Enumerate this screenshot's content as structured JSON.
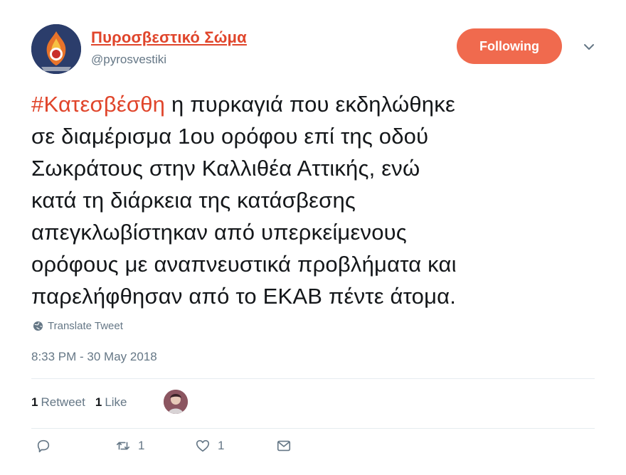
{
  "author": {
    "display_name": "Πυροσβεστικό Σώμα",
    "handle": "@pyrosvestiki"
  },
  "follow_button": {
    "label": "Following"
  },
  "tweet": {
    "hashtag": "#Κατεσβέσθη",
    "lines": [
      " η πυρκαγιά που εκδηλώθηκε",
      "σε διαμέρισμα 1ου ορόφου επί της οδού",
      "Σωκράτους στην Καλλιθέα Αττικής, ενώ",
      "κατά τη διάρκεια της κατάσβεσης",
      "απεγκλωβίστηκαν από υπερκείμενους",
      "ορόφους με αναπνευστικά προβλήματα και",
      "παρελήφθησαν από το ΕΚΑΒ πέντε άτομα."
    ]
  },
  "translate_label": "Translate Tweet",
  "timestamp": "8:33 PM - 30 May 2018",
  "stats": {
    "retweets_count": "1",
    "retweets_label": "Retweet",
    "likes_count": "1",
    "likes_label": "Like"
  },
  "actions": {
    "retweet_count": "1",
    "like_count": "1"
  },
  "colors": {
    "accent": "#e0452b",
    "follow_bg": "#f06a4e",
    "muted": "#657786",
    "text": "#14171a"
  }
}
